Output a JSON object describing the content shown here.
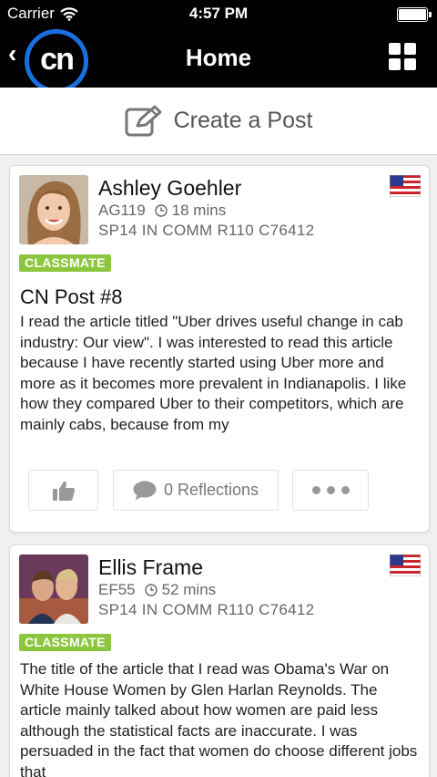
{
  "status": {
    "carrier": "Carrier",
    "time": "4:57 PM"
  },
  "nav": {
    "back": "‹",
    "logo": "cn",
    "title": "Home"
  },
  "create_post": {
    "label": "Create a Post"
  },
  "posts": [
    {
      "author": "Ashley Goehler",
      "code": "AG119",
      "time_ago": "18 mins",
      "course": "SP14 IN COMM R110 C76412",
      "badge": "CLASSMATE",
      "title": "CN Post #8",
      "body": "I read the article titled \"Uber drives useful change in cab industry: Our view\". I was interested to read this article because I have recently started using Uber more and more as it becomes more prevalent in Indianapolis. I like how they compared Uber to their competitors, which are mainly cabs, because from my",
      "reflections": "0 Reflections"
    },
    {
      "author": "Ellis Frame",
      "code": "EF55",
      "time_ago": "52 mins",
      "course": "SP14 IN COMM R110 C76412",
      "badge": "CLASSMATE",
      "title": "",
      "body": "The title of the article that I read was Obama's War on White House Women by Glen Harlan Reynolds. The article mainly talked about how women are paid less although the statistical facts are inaccurate. I was persuaded in the fact that women do choose different jobs that"
    }
  ],
  "icons": {
    "wifi": "wifi-icon",
    "battery": "battery-icon",
    "grid": "grid-menu-icon",
    "edit": "edit-icon",
    "flag": "us-flag-icon",
    "clock": "clock-icon",
    "like": "thumbs-up-icon",
    "comment": "comment-icon",
    "more": "more-icon"
  },
  "colors": {
    "accent": "#1a6fe0",
    "badge": "#8cc63f",
    "nav": "#000000"
  }
}
